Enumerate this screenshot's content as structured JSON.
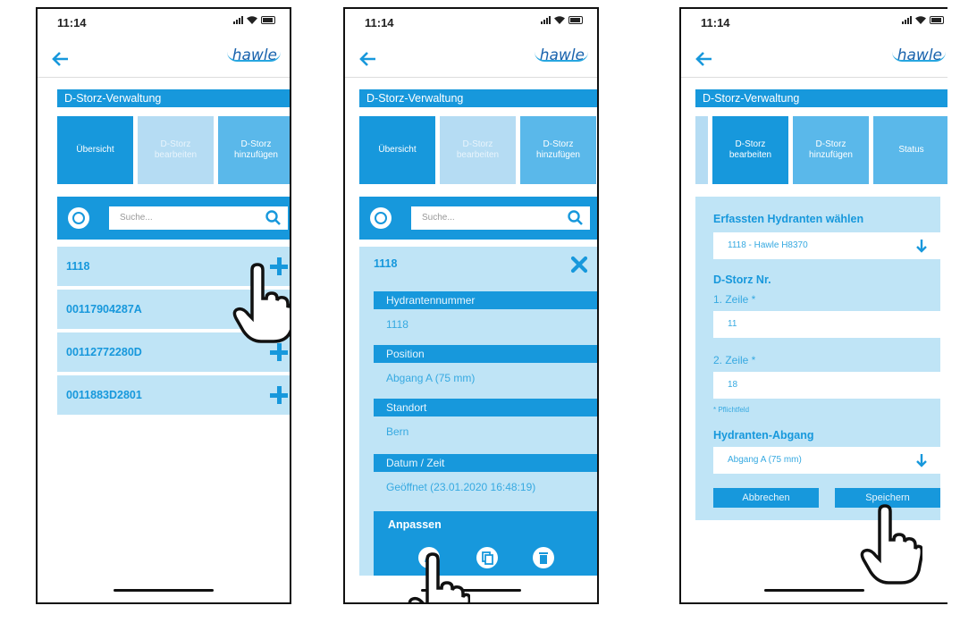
{
  "status_time": "11:14",
  "brand": "hawle",
  "section_title": "D-Storz-Verwaltung",
  "tabs": {
    "overview": "Übersicht",
    "edit": "D-Storz\nbearbeiten",
    "add": "D-Storz\nhinzufügen",
    "status": "Status"
  },
  "search": {
    "placeholder": "Suche..."
  },
  "list": [
    "1118",
    "00117904287A",
    "00112772280D",
    "0011883D2801"
  ],
  "detail": {
    "title": "1118",
    "fields": [
      {
        "label": "Hydrantennummer",
        "value": "1118"
      },
      {
        "label": "Position",
        "value": "Abgang A (75 mm)"
      },
      {
        "label": "Standort",
        "value": "Bern"
      },
      {
        "label": "Datum / Zeit",
        "value": "Geöffnet (23.01.2020 16:48:19)"
      }
    ],
    "adjust_title": "Anpassen"
  },
  "form": {
    "hydrant_heading": "Erfassten Hydranten wählen",
    "hydrant_value": "1118 - Hawle H8370",
    "storz_heading": "D-Storz Nr.",
    "line1_label": "1. Zeile *",
    "line1_value": "11",
    "line2_label": "2. Zeile *",
    "line2_value": "18",
    "required_note": "* Pflichtfeld",
    "outlet_heading": "Hydranten-Abgang",
    "outlet_value": "Abgang A (75 mm)",
    "cancel": "Abbrechen",
    "save": "Speichern"
  },
  "colors": {
    "primary": "#1798dc",
    "light": "#bfe4f6",
    "tab_light": "#b5dcf3",
    "tab_mid": "#5ab8ea"
  }
}
